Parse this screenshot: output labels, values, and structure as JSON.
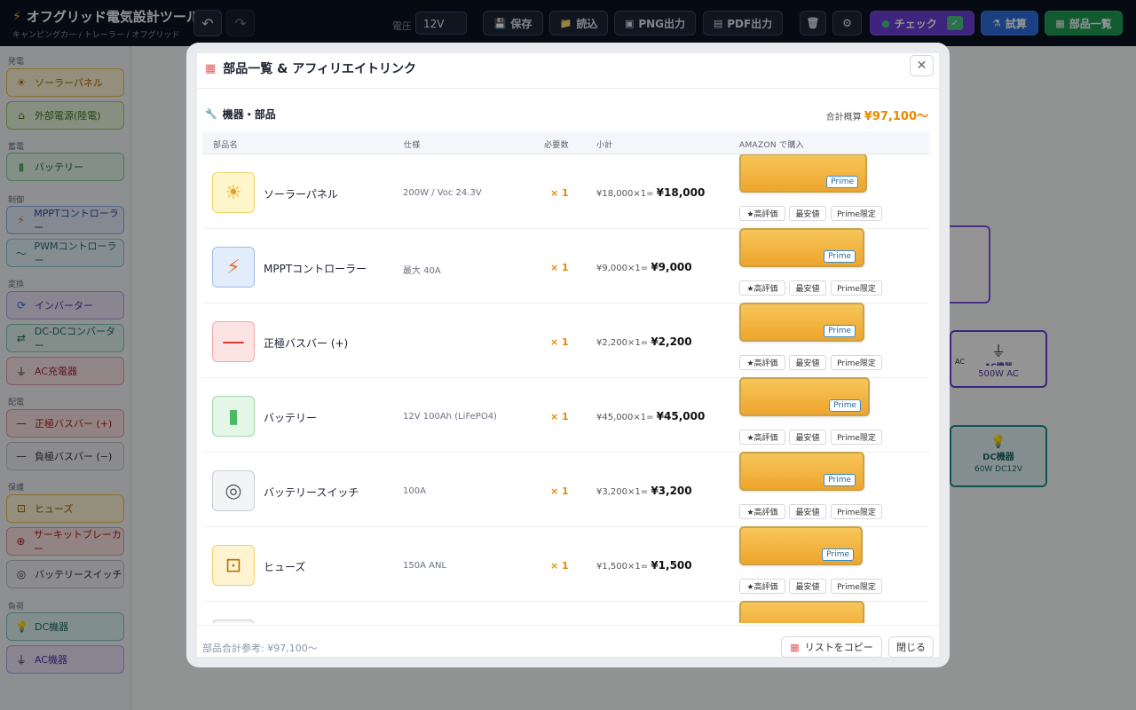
{
  "app": {
    "title": "オフグリッド電気設計ツール",
    "subtitle": "キャンピングカー / トレーラー / オフグリッド"
  },
  "toolbar": {
    "voltage_label": "電圧",
    "voltage_value": "12V",
    "save": "保存",
    "load": "読込",
    "png": "PNG出力",
    "pdf": "PDF出力",
    "check": "チェック",
    "trial": "試算",
    "parts": "部品一覧"
  },
  "sidebar": {
    "sections": [
      "発電",
      "蓄電",
      "制御",
      "変換",
      "配電",
      "保護",
      "負荷"
    ],
    "items": [
      {
        "label": "ソーラーパネル",
        "icon": "sun-icon"
      },
      {
        "label": "外部電源(陸電)",
        "icon": "house-icon"
      },
      {
        "label": "バッテリー",
        "icon": "battery-icon"
      },
      {
        "label": "MPPTコントローラー",
        "icon": "bolt-icon"
      },
      {
        "label": "PWMコントローラー",
        "icon": "wave-icon"
      },
      {
        "label": "インバーター",
        "icon": "cycle-icon"
      },
      {
        "label": "DC-DCコンバーター",
        "icon": "arrows-icon"
      },
      {
        "label": "AC充電器",
        "icon": "plug-icon"
      },
      {
        "label": "正極バスバー (+)",
        "icon": "line-icon"
      },
      {
        "label": "負極バスバー (−)",
        "icon": "line-icon"
      },
      {
        "label": "ヒューズ",
        "icon": "fuse-icon"
      },
      {
        "label": "サーキットブレーカー",
        "icon": "breaker-icon"
      },
      {
        "label": "バッテリースイッチ",
        "icon": "switch-icon"
      },
      {
        "label": "DC機器",
        "icon": "bulb-icon"
      },
      {
        "label": "AC機器",
        "icon": "plug-icon"
      }
    ]
  },
  "canvas": {
    "node_ac_short": "AC",
    "node_ac_title": "AC機器",
    "node_ac_sub": "500W AC",
    "node_dc_title": "DC機器",
    "node_dc_sub": "60W DC12V"
  },
  "modal": {
    "title": "部品一覧 & アフィリエイトリンク",
    "section_title": "機器・部品",
    "total_label": "合計概算",
    "total_value": "¥97,100〜",
    "columns": [
      "部品名",
      "仕様",
      "必要数",
      "小計",
      "AMAZON で購入"
    ],
    "prime_label": "Prime",
    "tags": [
      "★高評価",
      "最安値",
      "Prime限定"
    ],
    "rows": [
      {
        "name": "ソーラーパネル",
        "spec": "200W / Voc 24.3V",
        "qty": "× 1",
        "calc": "¥18,000×1=",
        "subtotal": "¥18,000",
        "icon": "sun-icon"
      },
      {
        "name": "MPPTコントローラー",
        "spec": "最大 40A",
        "qty": "× 1",
        "calc": "¥9,000×1=",
        "subtotal": "¥9,000",
        "icon": "bolt-icon"
      },
      {
        "name": "正極バスバー (+)",
        "spec": "",
        "qty": "× 1",
        "calc": "¥2,200×1=",
        "subtotal": "¥2,200",
        "icon": "busbar-icon"
      },
      {
        "name": "バッテリー",
        "spec": "12V 100Ah (LiFePO4)",
        "qty": "× 1",
        "calc": "¥45,000×1=",
        "subtotal": "¥45,000",
        "icon": "battery-icon"
      },
      {
        "name": "バッテリースイッチ",
        "spec": "100A",
        "qty": "× 1",
        "calc": "¥3,200×1=",
        "subtotal": "¥3,200",
        "icon": "switch-icon"
      },
      {
        "name": "ヒューズ",
        "spec": "150A ANL",
        "qty": "× 1",
        "calc": "¥1,500×1=",
        "subtotal": "¥1,500",
        "icon": "fuse-icon"
      }
    ],
    "footer_total": "部品合計参考: ¥97,100〜",
    "copy_button": "リストをコピー",
    "close_button": "閉じる"
  }
}
